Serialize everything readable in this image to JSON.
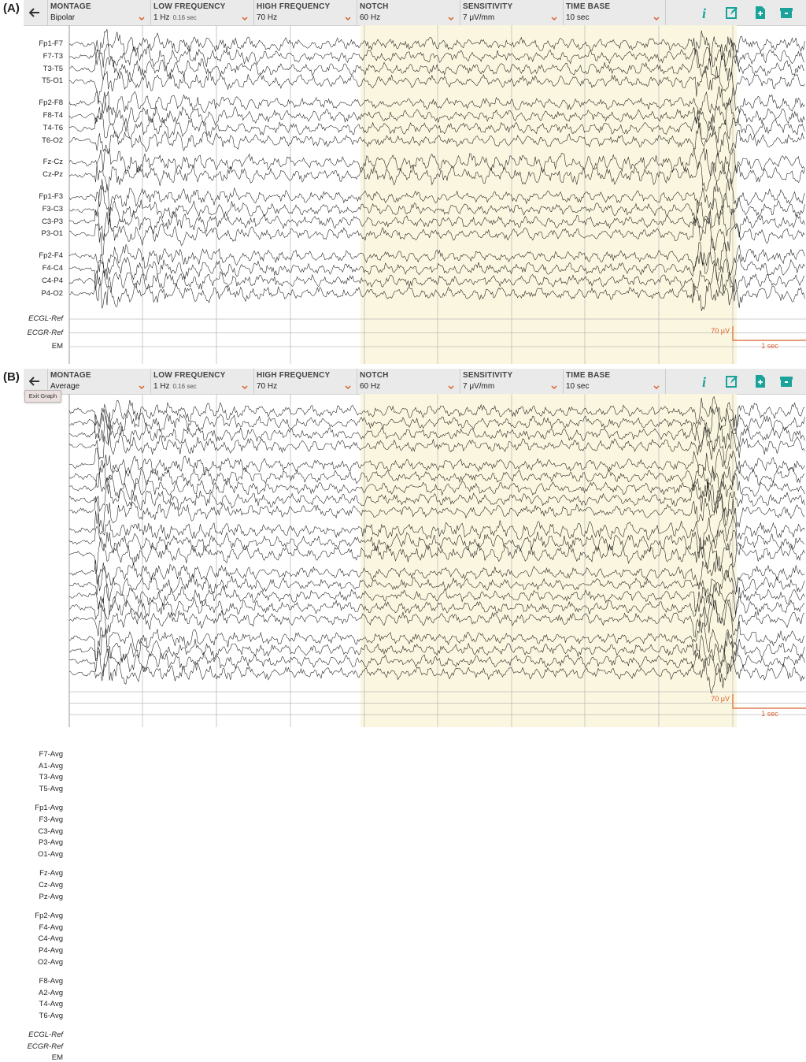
{
  "panels": [
    {
      "letter": "(A)",
      "toolbar": {
        "montage": {
          "label": "MONTAGE",
          "value": "Bipolar"
        },
        "low_frequency": {
          "label": "LOW FREQUENCY",
          "value": "1 Hz",
          "sub": "0.16 sec"
        },
        "high_frequency": {
          "label": "HIGH FREQUENCY",
          "value": "70 Hz"
        },
        "notch": {
          "label": "NOTCH",
          "value": "60 Hz"
        },
        "sensitivity": {
          "label": "SENSITIVITY",
          "value": "7 μV/mm"
        },
        "time_base": {
          "label": "TIME BASE",
          "value": "10 sec"
        },
        "icons": [
          "back-arrow-icon",
          "info-icon",
          "edit-note-icon",
          "add-file-icon",
          "archive-icon"
        ]
      },
      "channel_groups": [
        [
          "Fp1-F7",
          "F7-T3",
          "T3-T5",
          "T5-O1"
        ],
        [
          "Fp2-F8",
          "F8-T4",
          "T4-T6",
          "T6-O2"
        ],
        [
          "Fz-Cz",
          "Cz-Pz"
        ],
        [
          "Fp1-F3",
          "F3-C3",
          "C3-P3",
          "P3-O1"
        ],
        [
          "Fp2-F4",
          "F4-C4",
          "C4-P4",
          "P4-O2"
        ]
      ],
      "aux_channels": [
        "ECGL-Ref",
        "ECGR-Ref",
        "EM"
      ],
      "scale": {
        "amplitude": "70 μV",
        "time": "1 sec"
      }
    },
    {
      "letter": "(B)",
      "toolbar": {
        "montage": {
          "label": "MONTAGE",
          "value": "Average"
        },
        "low_frequency": {
          "label": "LOW FREQUENCY",
          "value": "1 Hz",
          "sub": "0.16 sec"
        },
        "high_frequency": {
          "label": "HIGH FREQUENCY",
          "value": "70 Hz"
        },
        "notch": {
          "label": "NOTCH",
          "value": "60 Hz"
        },
        "sensitivity": {
          "label": "SENSITIVITY",
          "value": "7 μV/mm"
        },
        "time_base": {
          "label": "TIME BASE",
          "value": "10 sec"
        },
        "icons": [
          "back-arrow-icon",
          "info-icon",
          "edit-note-icon",
          "add-file-icon",
          "archive-icon"
        ]
      },
      "tooltip": "Exit Graph",
      "channel_groups": [
        [
          "F7-Avg",
          "A1-Avg",
          "T3-Avg",
          "T5-Avg"
        ],
        [
          "Fp1-Avg",
          "F3-Avg",
          "C3-Avg",
          "P3-Avg",
          "O1-Avg"
        ],
        [
          "Fz-Avg",
          "Cz-Avg",
          "Pz-Avg"
        ],
        [
          "Fp2-Avg",
          "F4-Avg",
          "C4-Avg",
          "P4-Avg",
          "O2-Avg"
        ],
        [
          "F8-Avg",
          "A2-Avg",
          "T4-Avg",
          "T6-Avg"
        ]
      ],
      "aux_channels": [
        "ECGL-Ref",
        "ECGR-Ref",
        "EM"
      ],
      "scale": {
        "amplitude": "70 μV",
        "time": "1 sec"
      }
    }
  ],
  "colors": {
    "accent": "#1aa39a",
    "highlight": "#fbf6df",
    "scale": "#d9602e",
    "trace": "#1a1a1a",
    "caret": "#d9602e"
  }
}
